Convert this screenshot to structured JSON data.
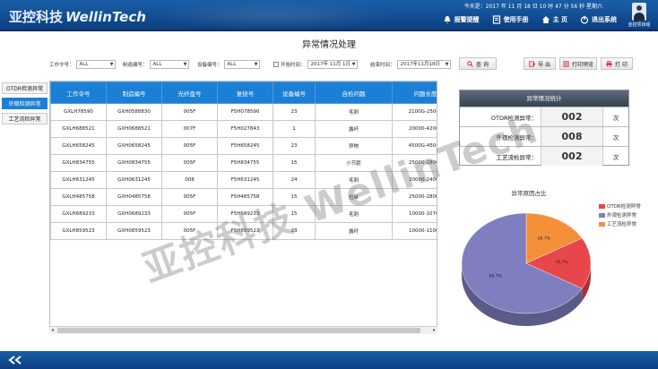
{
  "header": {
    "logo_cn": "亚控科技",
    "logo_en": "WellinTech",
    "datetime": "今天是：2017 年 11 月 18 日 10 时 47 分 56 秒 星期六",
    "nav": [
      {
        "label": "报警提醒",
        "icon": "bell-icon"
      },
      {
        "label": "使用手册",
        "icon": "book-icon"
      },
      {
        "label": "主 页",
        "icon": "home-icon"
      },
      {
        "label": "退出系统",
        "icon": "power-icon"
      }
    ],
    "user": "亚控项目组"
  },
  "page_title": "异常情况处理",
  "filters": {
    "work_order_label": "工作令号：",
    "work_order_value": "ALL",
    "mfg_no_label": "制造编号：",
    "mfg_no_value": "ALL",
    "device_no_label": "设备编号：",
    "device_no_value": "ALL",
    "start_label": "开始时间：",
    "start_value": "2017年 11月 1日",
    "end_label": "结束时间：",
    "end_value": "2017年11月18日",
    "query_btn": "查 询",
    "export_btn": "导 出",
    "preview_btn": "打印预览",
    "print_btn": "打 印"
  },
  "side_tabs": [
    "OTDR检测异常",
    "外观检测异常",
    "工艺流检异常"
  ],
  "table": {
    "columns": [
      "工作令号",
      "制造编号",
      "光纤盘号",
      "复绕号",
      "设备编号",
      "自检问题",
      "问题长度"
    ],
    "rows": [
      [
        "GXLH78590",
        "GXH0588830",
        "005F",
        "F5H078590",
        "23",
        "毛刺",
        "2100G-25000"
      ],
      [
        "GXLH688521",
        "GXH0688521",
        "007F",
        "F5H027843",
        "1",
        "露纤",
        "20000-42000"
      ],
      [
        "GXLH658245",
        "GXH0658245",
        "005F",
        "F5H658245",
        "23",
        "异物",
        "4500G-45000"
      ],
      [
        "GXLH834755",
        "GXH0834755",
        "005F",
        "F5H834755",
        "15",
        "小节距",
        "25000-28000"
      ],
      [
        "GXLH631245",
        "GXH0631245",
        "008",
        "F5H631245",
        "24",
        "毛刺",
        "20000-24000"
      ],
      [
        "GXLH485758",
        "GXH0485758",
        "005F",
        "F5H485758",
        "15",
        "拉丝",
        "25000-28000"
      ],
      [
        "GXLH689233",
        "GXH0689233",
        "005F",
        "F5H689233",
        "15",
        "毛刺",
        "10000-10700"
      ],
      [
        "GXLH859523",
        "GXH0859523",
        "005F",
        "F5H859523",
        "23",
        "露纤",
        "10000-11000"
      ]
    ]
  },
  "stats": {
    "title": "异常情况统计",
    "rows": [
      {
        "label": "OTDR检测异常：",
        "value": "002",
        "unit": "次"
      },
      {
        "label": "外观检测异常：",
        "value": "008",
        "unit": "次"
      },
      {
        "label": "工艺流检异常：",
        "value": "002",
        "unit": "次"
      }
    ]
  },
  "chart_data": {
    "type": "pie",
    "title": "异常原因占比",
    "categories": [
      "OTDR检测异常",
      "外观检测异常",
      "工艺流检异常"
    ],
    "values": [
      16.7,
      66.7,
      16.7
    ],
    "labels": [
      "16.7%",
      "66.7%",
      "16.7%"
    ],
    "colors": [
      "#e8464a",
      "#7f7fbf",
      "#f5903a"
    ],
    "legend": "right"
  },
  "watermark": "亚控科技 WellinTech",
  "colors": {
    "header": "#0c3f80",
    "accent": "#1c7fd6"
  }
}
